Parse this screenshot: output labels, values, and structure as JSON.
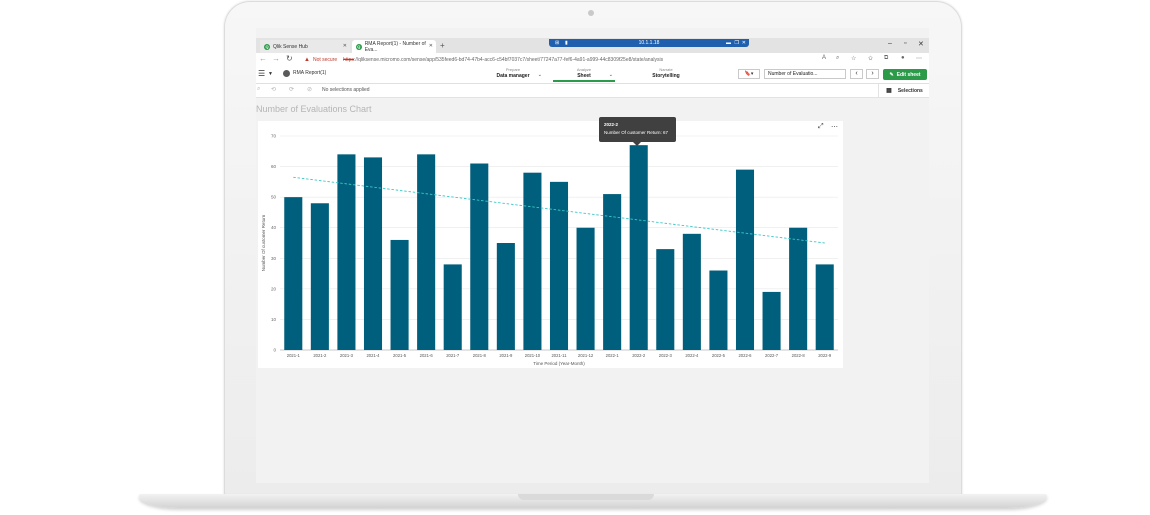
{
  "browser": {
    "tabs": [
      {
        "label": "Qlik Sense Hub"
      },
      {
        "label": "RMA Report(1) - Number of Eva..."
      }
    ],
    "remote_label": "10.1.1.18",
    "url": {
      "warning": "Not secure",
      "scheme": "https",
      "rest": "://qliksense.micromo.com/sense/app/535feed6-bd74-47b4-acc6-c54bf7037c7/sheet/77247a77-fef6-4a91-a999-44c8309f25e8/state/analysis"
    }
  },
  "qlik": {
    "app_title": "RMA Report(1)",
    "nav": [
      {
        "small": "Prepare",
        "label": "Data manager"
      },
      {
        "small": "Analyze",
        "label": "Sheet"
      },
      {
        "small": "Narrate",
        "label": "Storytelling"
      }
    ],
    "sheet_select": "Number of Evaluatio...",
    "edit_label": "Edit sheet",
    "no_selections": "No selections applied",
    "selections_label": "Selections",
    "sheet_title": "Number of Evaluations Chart"
  },
  "tooltip": {
    "title": "2022-2",
    "line": "Number Of customer Return: 67"
  },
  "colors": {
    "bar": "#005f7c",
    "trend": "#3cc8c8",
    "accent_green": "#2b9b49"
  },
  "chart_data": {
    "type": "bar",
    "categories": [
      "2021-1",
      "2021-2",
      "2021-3",
      "2021-4",
      "2021-5",
      "2021-6",
      "2021-7",
      "2021-8",
      "2021-9",
      "2021-10",
      "2021-11",
      "2021-12",
      "2022-1",
      "2022-2",
      "2022-3",
      "2022-4",
      "2022-5",
      "2022-6",
      "2022-7",
      "2022-8",
      "2022-9"
    ],
    "series": [
      {
        "values": [
          50,
          48,
          64,
          63,
          36,
          64,
          28,
          61,
          35,
          58,
          55,
          40,
          51,
          67,
          33,
          38,
          26,
          59,
          19,
          40,
          28
        ]
      }
    ],
    "trendline": {
      "start": 56.5,
      "end": 35
    },
    "xlabel": "Time Period (Year-Month)",
    "ylabel": "Number Of customer Return",
    "ylim": [
      0,
      70
    ],
    "yticks": [
      0,
      10,
      20,
      30,
      40,
      50,
      60,
      70
    ],
    "grid": true,
    "legend": "none"
  }
}
